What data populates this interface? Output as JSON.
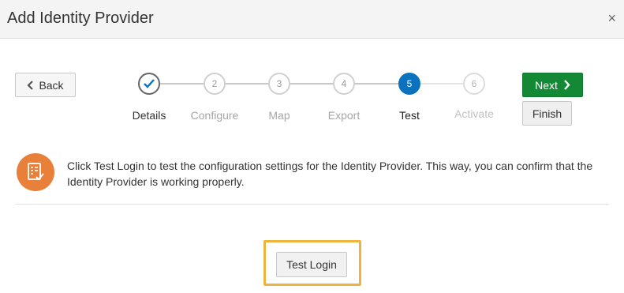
{
  "dialog": {
    "title": "Add Identity Provider",
    "close_glyph": "×",
    "close_icon": "close-icon"
  },
  "nav": {
    "back_label": "Back",
    "back_icon": "chevron-left-icon",
    "next_label": "Next",
    "next_icon": "chevron-right-icon",
    "finish_label": "Finish",
    "next_color": "#138936"
  },
  "train": {
    "current_step": 5,
    "current_color": "#0b72bd",
    "steps": [
      {
        "number": "",
        "label": "Details",
        "state": "completed",
        "icon": "checkmark-icon"
      },
      {
        "number": "2",
        "label": "Configure",
        "state": "visited"
      },
      {
        "number": "3",
        "label": "Map",
        "state": "visited"
      },
      {
        "number": "4",
        "label": "Export",
        "state": "visited"
      },
      {
        "number": "5",
        "label": "Test",
        "state": "current"
      },
      {
        "number": "6",
        "label": "Activate",
        "state": "disabled"
      }
    ]
  },
  "info": {
    "icon": "checklist-icon",
    "icon_color": "#e8803a",
    "text": "Click Test Login to test the configuration settings for the Identity Provider. This way, you can confirm that the Identity Provider is working properly."
  },
  "action": {
    "test_login_label": "Test Login",
    "highlight_color": "#f0b43c"
  }
}
